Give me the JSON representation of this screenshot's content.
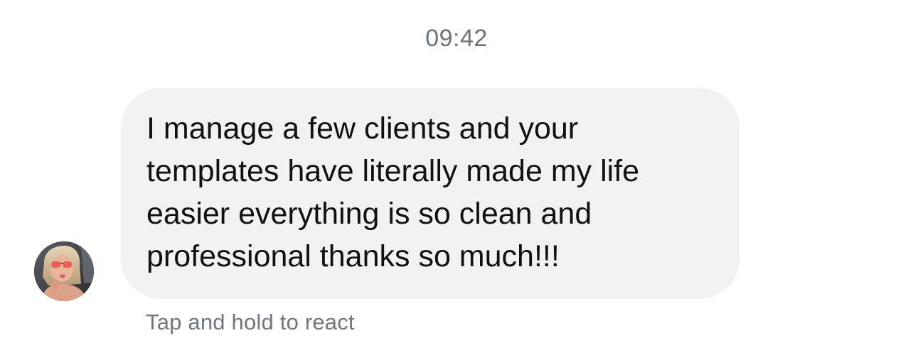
{
  "conversation": {
    "timestamp": "09:42",
    "message": {
      "lines": [
        "I manage a few clients and your",
        "templates have literally made my life",
        "easier everything is so clean and",
        "professional thanks so much!!!"
      ]
    },
    "hint": "Tap and hold to react",
    "avatar": {
      "icon": "profile-photo"
    }
  },
  "colors": {
    "bubble_background": "#f1f2f4",
    "message_text": "#111111",
    "secondary_text": "#6e7279",
    "page_background": "#ffffff"
  }
}
